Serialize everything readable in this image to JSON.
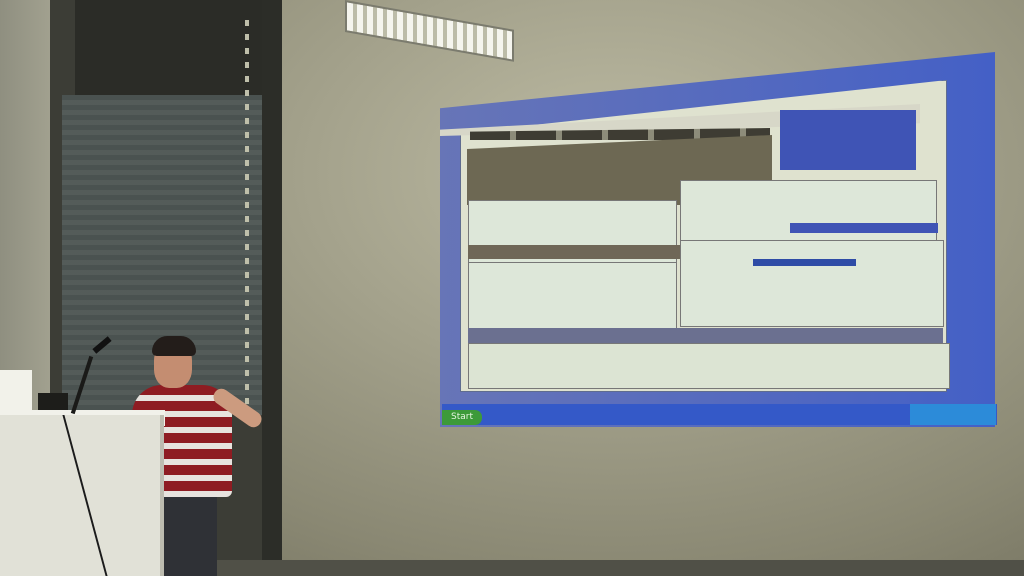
{
  "scene": {
    "projected_desktop": {
      "start_button_label": "Start"
    }
  },
  "colors": {
    "projection_blue": "#4460c6",
    "taskbar_blue": "#3459c8",
    "start_green": "#3d9a39",
    "shirt_red": "#8e1c22",
    "shirt_white": "#e7e3de"
  }
}
